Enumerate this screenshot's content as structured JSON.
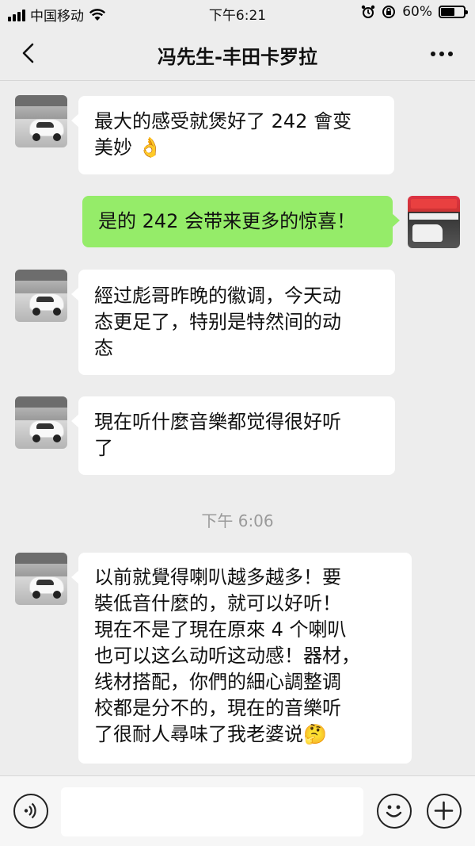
{
  "status": {
    "carrier": "中国移动",
    "time": "下午6:21",
    "battery": "60%",
    "battery_level": 0.6
  },
  "nav": {
    "title": "冯先生-丰田卡罗拉"
  },
  "messages": [
    {
      "sender": "other",
      "lines": [
        "最大的感受就煲好了 242 會变",
        "美妙"
      ],
      "emoji": "👌"
    },
    {
      "sender": "self",
      "lines": [
        "是的 242 会带来更多的惊喜！"
      ]
    },
    {
      "sender": "other",
      "lines": [
        "經过彪哥昨晚的徽调，今天动",
        "态更足了，特别是特然间的动",
        "态"
      ]
    },
    {
      "sender": "other",
      "lines": [
        "現在听什麼音樂都觉得很好听",
        "了"
      ]
    },
    {
      "sender": "other",
      "lines": [
        "以前就覺得喇叭越多越多！要",
        "裝低音什麼的，就可以好听！",
        "現在不是了現在原來 4 个喇叭",
        "也可以这么动听这动感！器材，",
        "线材搭配，你們的細心調整调",
        "校都是分不的，現在的音樂听",
        "了很耐人尋味了我老婆说"
      ],
      "emoji": "🤔"
    }
  ],
  "timestamp": "下午 6:06",
  "icons": {
    "signal": "signal-icon",
    "wifi": "wifi-icon",
    "alarm": "alarm-icon",
    "orientation_lock": "orientation-lock-icon",
    "battery": "battery-icon",
    "back": "back-chevron-icon",
    "more": "more-dots-icon",
    "voice": "voice-icon",
    "emoji": "emoji-icon",
    "plus": "plus-icon"
  },
  "colors": {
    "background": "#ededed",
    "self_bubble": "#95ec69",
    "other_bubble": "#ffffff",
    "timestamp": "#9a9a9a"
  }
}
